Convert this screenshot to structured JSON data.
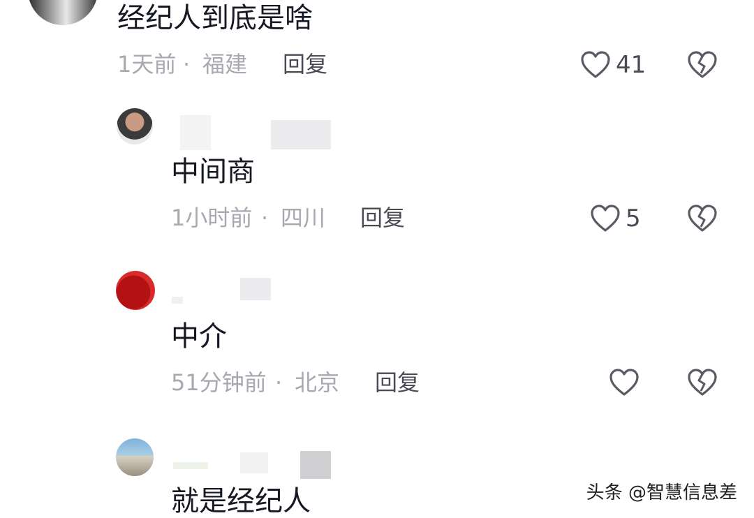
{
  "comments": [
    {
      "text": "经纪人到底是啥",
      "time": "1天前",
      "sep": "·",
      "location": "福建",
      "reply_label": "回复",
      "like_count": "41"
    },
    {
      "text": "中间商",
      "time": "1小时前",
      "sep": "·",
      "location": "四川",
      "reply_label": "回复",
      "like_count": "5"
    },
    {
      "text": "中介",
      "time": "51分钟前",
      "sep": "·",
      "location": "北京",
      "reply_label": "回复",
      "like_count": ""
    },
    {
      "text": "就是经纪人"
    }
  ],
  "watermark": "头条 @智慧信息差",
  "icons": {
    "like": "heart-outline-icon",
    "dislike": "broken-heart-icon"
  },
  "colors": {
    "text": "#161823",
    "meta": "#a8a8b0",
    "icon": "#5a5a64"
  }
}
